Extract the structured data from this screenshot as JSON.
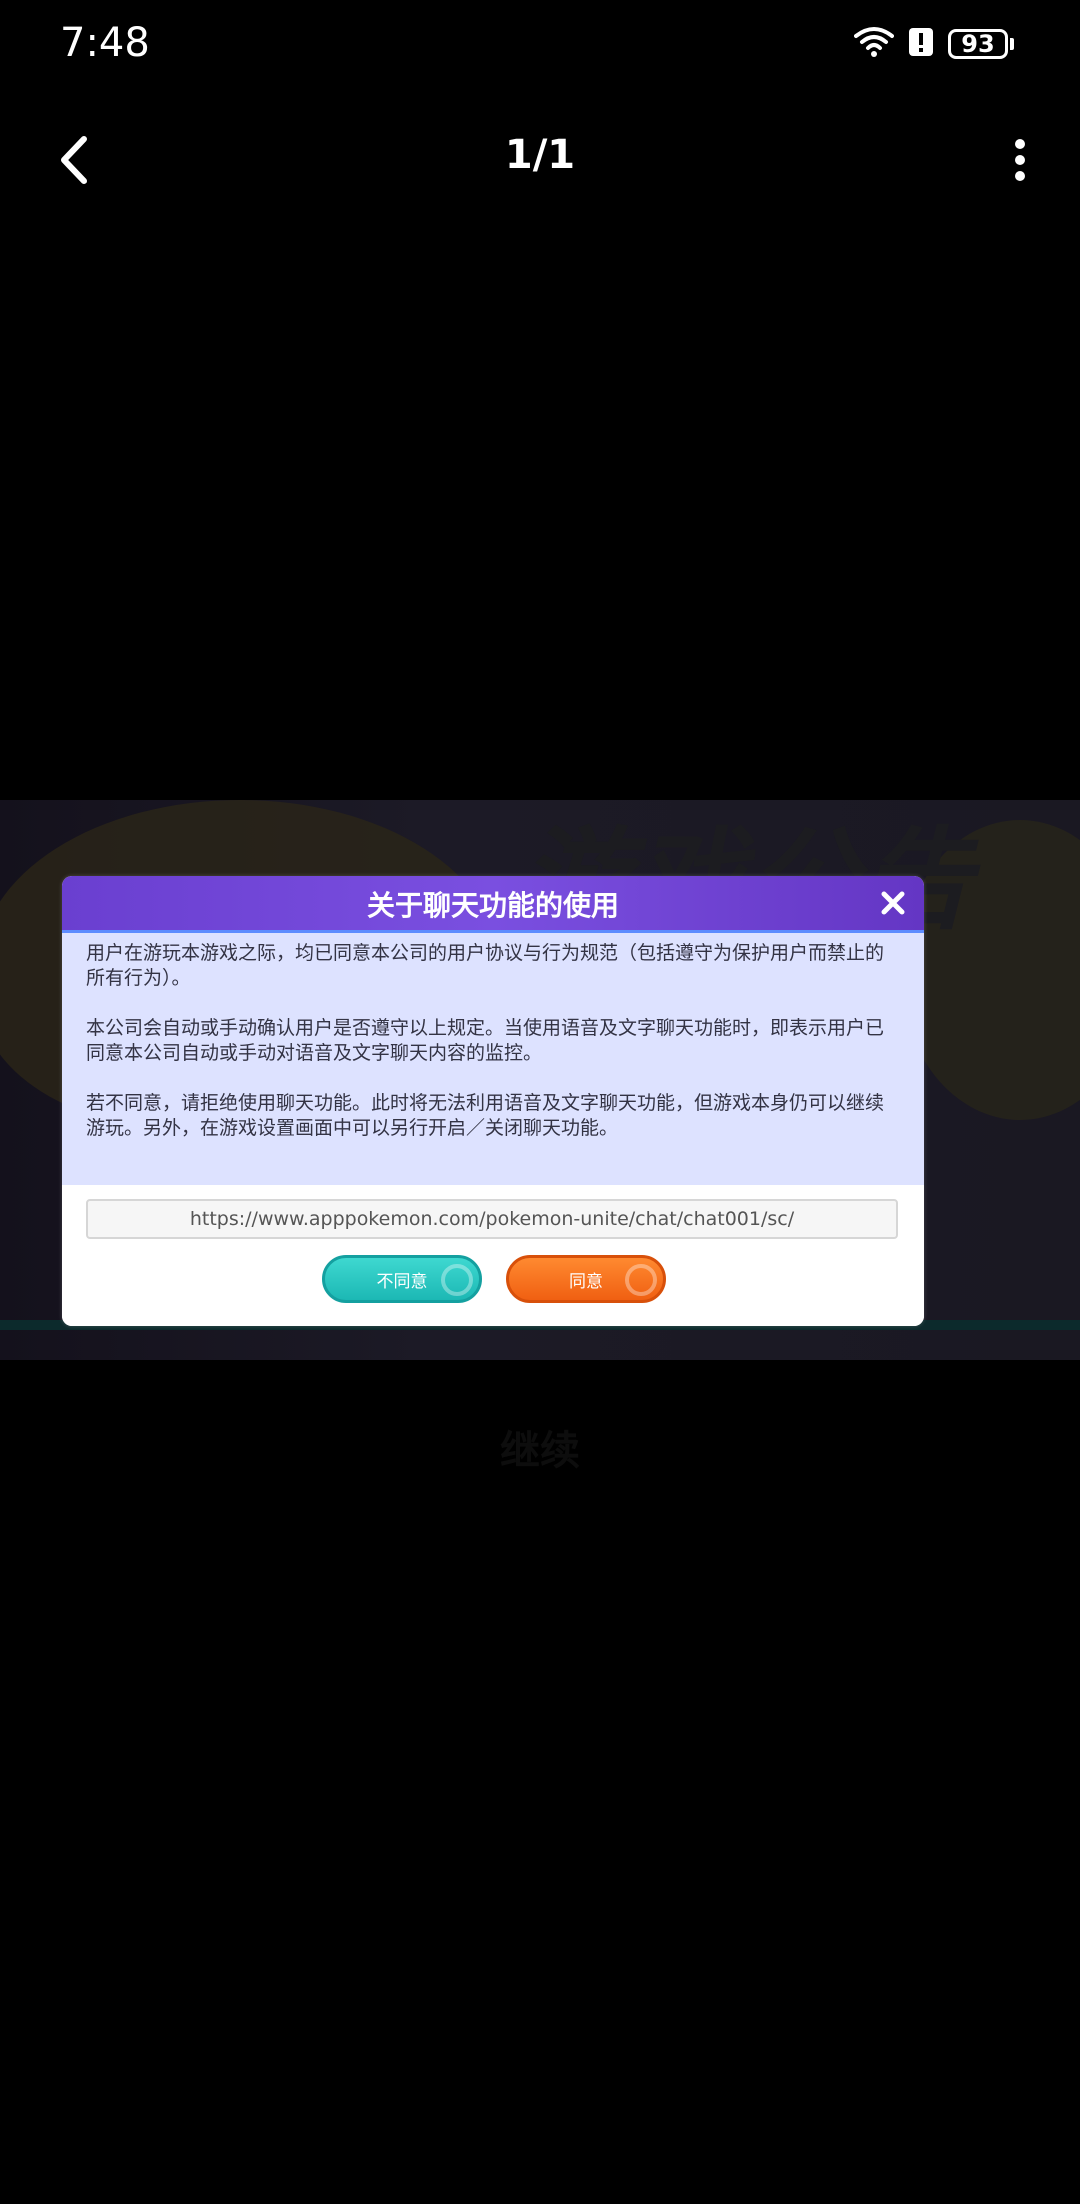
{
  "status_bar": {
    "time": "7:48",
    "battery_level": "93",
    "icons": [
      "wifi-icon",
      "alert-icon",
      "battery-icon"
    ]
  },
  "top_nav": {
    "page_counter": "1/1",
    "back_icon": "chevron-left-icon",
    "more_icon": "more-vertical-icon"
  },
  "background": {
    "title": "游戏公告",
    "continue_label": "继续"
  },
  "dialog": {
    "title": "关于聊天功能的使用",
    "paragraphs": [
      "用户在游玩本游戏之际，均已同意本公司的用户协议与行为规范（包括遵守为保护用户而禁止的所有行为）。",
      "本公司会自动或手动确认用户是否遵守以上规定。当使用语音及文字聊天功能时，即表示用户已同意本公司自动或手动对语音及文字聊天内容的监控。",
      "若不同意，请拒绝使用聊天功能。此时将无法利用语音及文字聊天功能，但游戏本身仍可以继续游玩。另外，在游戏设置画面中可以另行开启／关闭聊天功能。"
    ],
    "url": "https://www.apppokemon.com/pokemon-unite/chat/chat001/sc/",
    "disagree_label": "不同意",
    "agree_label": "同意"
  },
  "colors": {
    "header": "#6a3fd0",
    "body_bg": "#dde2ff",
    "disagree": "#1cb8b4",
    "agree": "#f06012"
  }
}
